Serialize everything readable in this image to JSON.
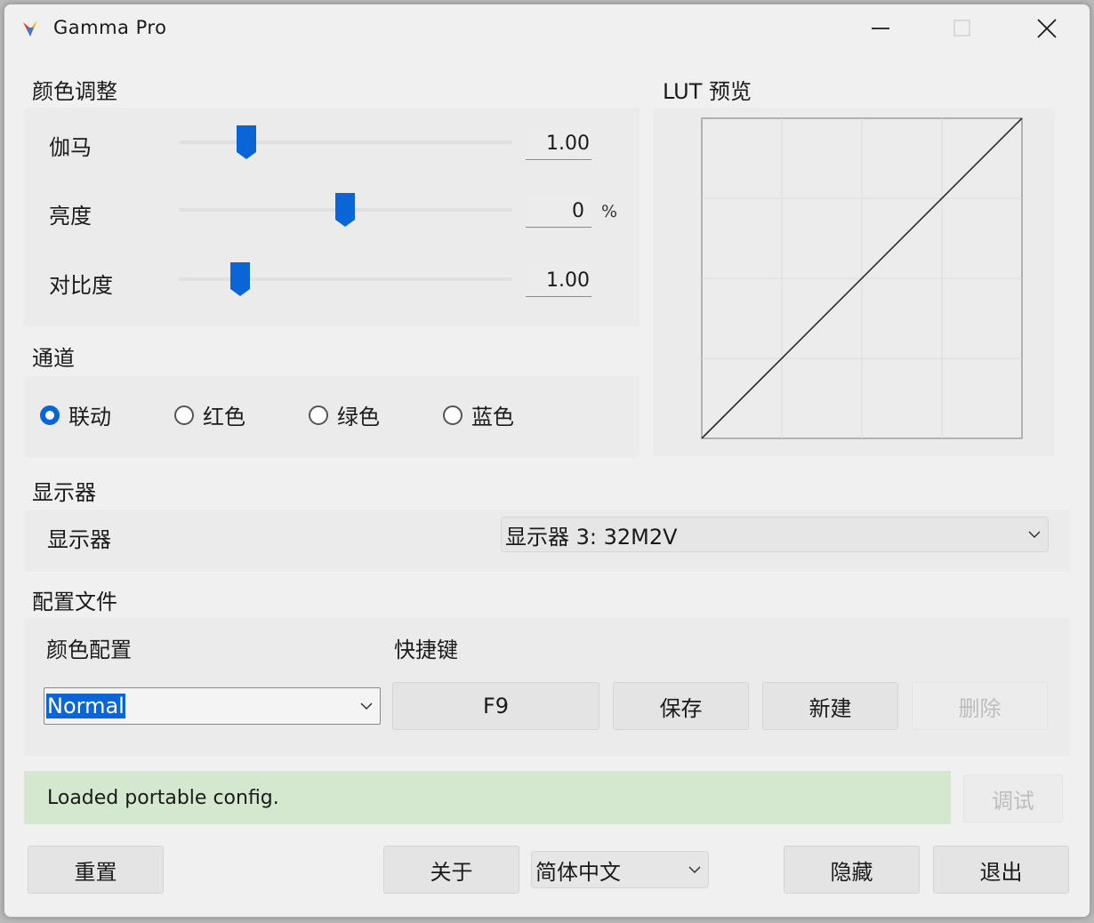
{
  "window": {
    "title": "Gamma Pro",
    "minimize_icon": "minimize-icon",
    "maximize_icon": "maximize-icon",
    "close_icon": "close-icon"
  },
  "color_adjust": {
    "title": "颜色调整",
    "gamma": {
      "label": "伽马",
      "value": "1.00",
      "slider_fraction": 0.2
    },
    "brightness": {
      "label": "亮度",
      "value": "0",
      "unit": "%",
      "slider_fraction": 0.5
    },
    "contrast": {
      "label": "对比度",
      "value": "1.00",
      "slider_fraction": 0.18
    }
  },
  "lut": {
    "title": "LUT 预览"
  },
  "channel": {
    "title": "通道",
    "options": [
      {
        "label": "联动",
        "checked": true
      },
      {
        "label": "红色",
        "checked": false
      },
      {
        "label": "绿色",
        "checked": false
      },
      {
        "label": "蓝色",
        "checked": false
      }
    ]
  },
  "display": {
    "title": "显示器",
    "label": "显示器",
    "selected": "显示器 3: 32M2V"
  },
  "profile": {
    "title": "配置文件",
    "color_config_label": "颜色配置",
    "hotkey_label": "快捷键",
    "selected": "Normal",
    "hotkey": "F9",
    "save": "保存",
    "new": "新建",
    "delete": "删除"
  },
  "status": {
    "text": "Loaded portable config.",
    "debug": "调试"
  },
  "footer": {
    "reset": "重置",
    "about": "关于",
    "language": "简体中文",
    "hide": "隐藏",
    "exit": "退出"
  },
  "colors": {
    "accent": "#0a66d6",
    "status_bg": "#d4e8cf",
    "window_bg": "#f0f0f0"
  }
}
